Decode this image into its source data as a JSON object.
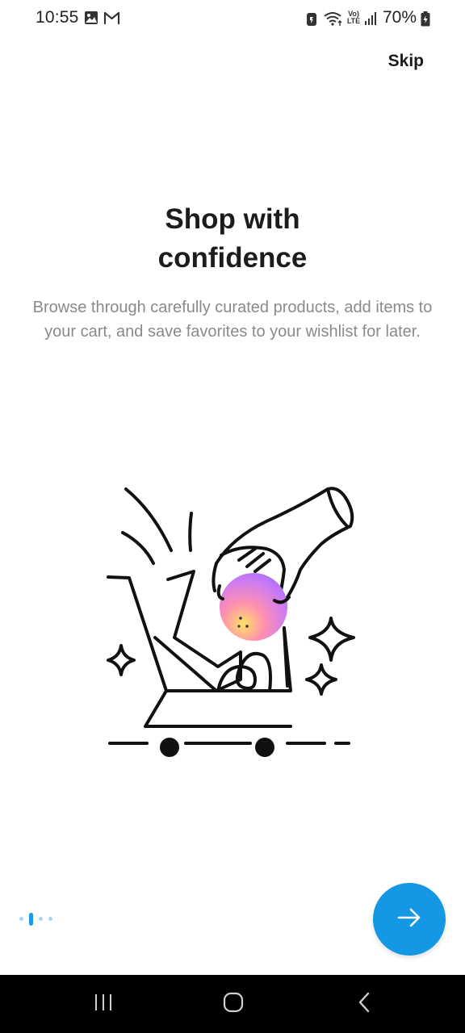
{
  "status_bar": {
    "time": "10:55",
    "battery_percent": "70%",
    "left_icons": [
      "gallery-icon",
      "gmail-icon"
    ],
    "right_icons": [
      "battery-saver-icon",
      "wifi-icon",
      "volte-icon",
      "signal-icon",
      "battery-icon"
    ],
    "volte_label_top": "Vo)",
    "volte_label_bottom": "LTE"
  },
  "onboarding": {
    "skip_label": "Skip",
    "title_line1": "Shop with",
    "title_line2": "confidence",
    "description": "Browse through carefully curated products, add items to your cart, and save favorites to your wishlist for later.",
    "illustration": "shopping-cart-hand-illustration",
    "pager": {
      "total": 4,
      "current": 2
    },
    "next_icon": "arrow-right-icon"
  },
  "colors": {
    "accent": "#1598e4",
    "pager_active": "#1e9be6",
    "pager_inactive": "#a8d5f2",
    "description_text": "#8a8a8a",
    "nav_bar": "#000000"
  },
  "nav_bar": {
    "buttons": [
      "recent-apps-icon",
      "home-icon",
      "back-icon"
    ]
  }
}
